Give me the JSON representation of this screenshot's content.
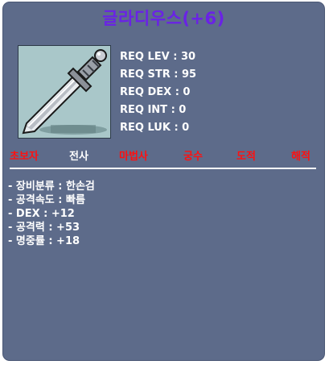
{
  "item": {
    "name": "글라디우스(+6)",
    "icon": "gladius-sword-icon"
  },
  "requirements": [
    {
      "label": "REQ LEV : 30"
    },
    {
      "label": "REQ STR : 95"
    },
    {
      "label": "REQ DEX : 0"
    },
    {
      "label": "REQ INT : 0"
    },
    {
      "label": "REQ LUK : 0"
    }
  ],
  "jobs": [
    {
      "label": "초보자",
      "allowed": false,
      "color": "#ff1010"
    },
    {
      "label": "전사",
      "allowed": true,
      "color": "#ffffff"
    },
    {
      "label": "마법사",
      "allowed": false,
      "color": "#ff1010"
    },
    {
      "label": "궁수",
      "allowed": false,
      "color": "#ff1010"
    },
    {
      "label": "도적",
      "allowed": false,
      "color": "#ff1010"
    },
    {
      "label": "해적",
      "allowed": false,
      "color": "#ff1010"
    }
  ],
  "stats": [
    {
      "text": "- 장비분류 : 한손검"
    },
    {
      "text": "- 공격속도 : 빠름"
    },
    {
      "text": "- DEX : +12"
    },
    {
      "text": "- 공격력 : +53"
    },
    {
      "text": "- 명중률 : +18"
    }
  ],
  "colors": {
    "background": "#5d6b8a",
    "title": "#6a22e6",
    "unavailable_job": "#ff1010",
    "available_job": "#ffffff"
  }
}
